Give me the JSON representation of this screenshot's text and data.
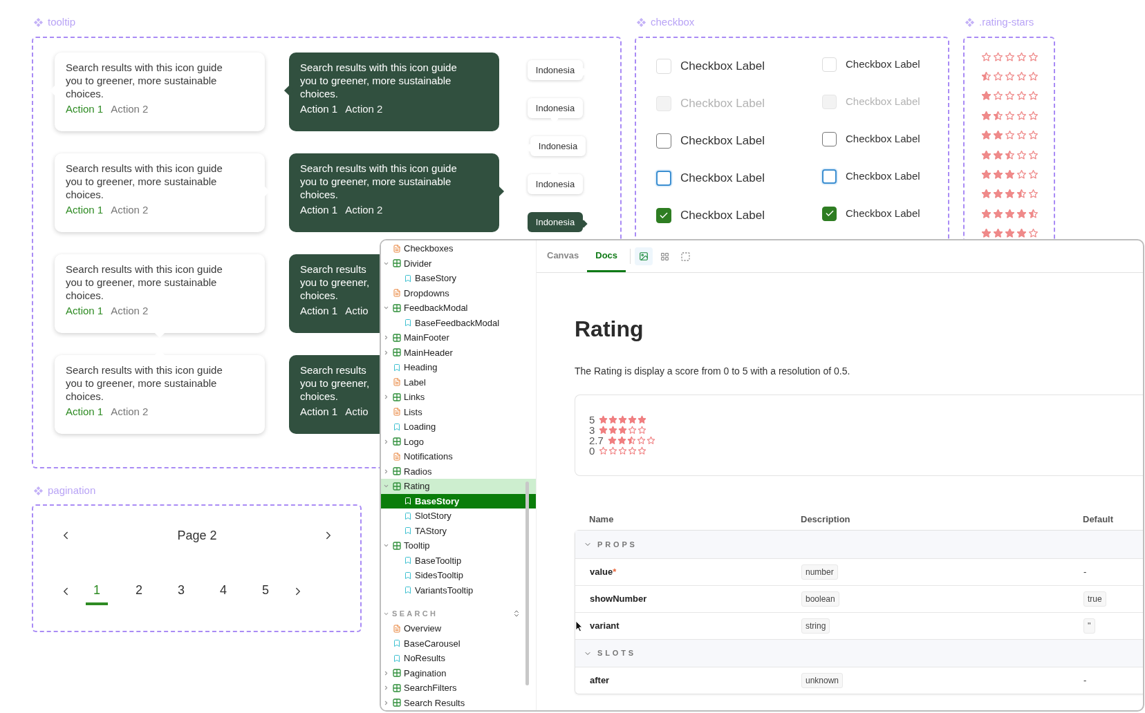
{
  "tooltip_frame": {
    "title": "tooltip",
    "light_column": [
      {
        "text": "Search results with this icon guide you to greener, more sustainable choices.",
        "actions": [
          {
            "label": "Action 1",
            "kind": "primary"
          },
          {
            "label": "Action 2",
            "kind": "secondary"
          }
        ]
      },
      {
        "text": "Search results with this icon guide you to greener, more sustainable choices.",
        "actions": [
          {
            "label": "Action 1",
            "kind": "primary"
          },
          {
            "label": "Action 2",
            "kind": "secondary"
          }
        ]
      },
      {
        "text": "Search results with this icon guide you to greener, more sustainable choices.",
        "actions": [
          {
            "label": "Action 1",
            "kind": "primary"
          },
          {
            "label": "Action 2",
            "kind": "secondary"
          }
        ]
      },
      {
        "text": "Search results with this icon guide you to greener, more sustainable choices.",
        "actions": [
          {
            "label": "Action 1",
            "kind": "primary"
          },
          {
            "label": "Action 2",
            "kind": "secondary"
          }
        ]
      }
    ],
    "dark_column": [
      {
        "text": "Search results with this icon guide you to greener, more sustainable choices.",
        "actions": [
          {
            "label": "Action 1",
            "kind": "primary"
          },
          {
            "label": "Action 2",
            "kind": "secondary"
          }
        ]
      },
      {
        "text": "Search results with this icon guide you to greener, more sustainable choices.",
        "actions": [
          {
            "label": "Action 1",
            "kind": "primary"
          },
          {
            "label": "Action 2",
            "kind": "secondary"
          }
        ]
      },
      {
        "lines": [
          "Search results",
          "you to greener,",
          "choices."
        ],
        "actions": [
          {
            "label": "Action 1",
            "kind": "primary"
          },
          {
            "label": "Actio",
            "kind": "secondary"
          }
        ]
      },
      {
        "lines": [
          "Search results",
          "you to greener,",
          "choices."
        ],
        "actions": [
          {
            "label": "Action 1",
            "kind": "primary"
          },
          {
            "label": "Actio",
            "kind": "secondary"
          }
        ]
      }
    ],
    "chips": [
      {
        "label": "Indonesia",
        "kind": "light"
      },
      {
        "label": "Indonesia",
        "kind": "light"
      },
      {
        "label": "Indonesia",
        "kind": "light"
      },
      {
        "label": "Indonesia",
        "kind": "light"
      },
      {
        "label": "Indonesia",
        "kind": "dark"
      }
    ]
  },
  "checkbox_frame": {
    "title": "checkbox",
    "columns": [
      {
        "kind": "large",
        "items": [
          {
            "label": "Checkbox Label",
            "kind": "default",
            "checked": false
          },
          {
            "label": "Checkbox Label",
            "kind": "disabled",
            "checked": false
          },
          {
            "label": "Checkbox Label",
            "kind": "hover",
            "checked": false
          },
          {
            "label": "Checkbox Label",
            "kind": "focus",
            "checked": false
          },
          {
            "label": "Checkbox Label",
            "kind": "default",
            "checked": true
          }
        ]
      },
      {
        "kind": "small",
        "items": [
          {
            "label": "Checkbox Label",
            "kind": "default",
            "checked": false
          },
          {
            "label": "Checkbox Label",
            "kind": "disabled",
            "checked": false
          },
          {
            "label": "Checkbox Label",
            "kind": "hover",
            "checked": false
          },
          {
            "label": "Checkbox Label",
            "kind": "focus",
            "checked": false
          },
          {
            "label": "Checkbox Label",
            "kind": "default",
            "checked": true
          }
        ]
      }
    ]
  },
  "rating_frame": {
    "title": ".rating-stars",
    "rows": [
      {
        "stars": 0
      },
      {
        "stars": 0.5
      },
      {
        "stars": 1
      },
      {
        "stars": 1.5
      },
      {
        "stars": 2
      },
      {
        "stars": 2.5
      },
      {
        "stars": 3
      },
      {
        "stars": 3.5
      },
      {
        "stars": 4.5
      },
      {
        "stars": 4
      }
    ]
  },
  "pagination_frame": {
    "title": "pagination",
    "page_label": "Page 2",
    "pages": [
      {
        "label": "1",
        "selected": true
      },
      {
        "label": "2",
        "selected": false
      },
      {
        "label": "3",
        "selected": false
      },
      {
        "label": "4",
        "selected": false
      },
      {
        "label": "5",
        "selected": false
      }
    ]
  },
  "storybook": {
    "sidebar": {
      "sections": [
        {
          "items": [
            {
              "label": "Checkboxes",
              "kind": "doc",
              "selected": false
            },
            {
              "label": "Divider",
              "kind": "component",
              "expanded": true,
              "selected": false,
              "children": [
                {
                  "label": "BaseStory",
                  "kind": "story",
                  "selected": false
                }
              ]
            },
            {
              "label": "Dropdowns",
              "kind": "doc",
              "selected": false
            },
            {
              "label": "FeedbackModal",
              "kind": "component",
              "expanded": true,
              "selected": false,
              "children": [
                {
                  "label": "BaseFeedbackModal",
                  "kind": "story",
                  "selected": false
                }
              ]
            },
            {
              "label": "MainFooter",
              "kind": "component",
              "expanded": false,
              "selected": false
            },
            {
              "label": "MainHeader",
              "kind": "component",
              "expanded": false,
              "selected": false
            },
            {
              "label": "Heading",
              "kind": "story",
              "selected": false
            },
            {
              "label": "Label",
              "kind": "doc",
              "selected": false
            },
            {
              "label": "Links",
              "kind": "component",
              "expanded": false,
              "selected": false
            },
            {
              "label": "Lists",
              "kind": "doc",
              "selected": false
            },
            {
              "label": "Loading",
              "kind": "story",
              "selected": false
            },
            {
              "label": "Logo",
              "kind": "component",
              "expanded": false,
              "selected": false
            },
            {
              "label": "Notifications",
              "kind": "doc",
              "selected": false
            },
            {
              "label": "Radios",
              "kind": "component",
              "expanded": false,
              "selected": false
            },
            {
              "label": "Rating",
              "kind": "component",
              "expanded": true,
              "selected": false,
              "children": [
                {
                  "label": "BaseStory",
                  "kind": "story",
                  "selected": true
                },
                {
                  "label": "SlotStory",
                  "kind": "story",
                  "selected": false
                },
                {
                  "label": "TAStory",
                  "kind": "story",
                  "selected": false
                }
              ]
            },
            {
              "label": "Tooltip",
              "kind": "component",
              "expanded": true,
              "selected": false,
              "children": [
                {
                  "label": "BaseTooltip",
                  "kind": "story",
                  "selected": false
                },
                {
                  "label": "SidesTooltip",
                  "kind": "story",
                  "selected": false
                },
                {
                  "label": "VariantsTooltip",
                  "kind": "story",
                  "selected": false
                }
              ]
            }
          ]
        },
        {
          "title": "SEARCH",
          "expanded": true,
          "items": [
            {
              "label": "Overview",
              "kind": "doc",
              "selected": false
            },
            {
              "label": "BaseCarousel",
              "kind": "story",
              "selected": false
            },
            {
              "label": "NoResults",
              "kind": "story",
              "selected": false
            },
            {
              "label": "Pagination",
              "kind": "component",
              "expanded": false,
              "selected": false
            },
            {
              "label": "SearchFilters",
              "kind": "component",
              "expanded": false,
              "selected": false
            },
            {
              "label": "Search Results",
              "kind": "component",
              "expanded": false,
              "selected": false
            }
          ]
        }
      ]
    },
    "tabs": [
      {
        "label": "Canvas",
        "selected": false
      },
      {
        "label": "Docs",
        "selected": true
      }
    ],
    "tools": [
      {
        "kind": "image",
        "selected": true
      },
      {
        "kind": "grid",
        "selected": false
      },
      {
        "kind": "outline",
        "selected": false
      }
    ],
    "docs": {
      "title": "Rating",
      "description": "The Rating is display a score from 0 to 5 with a resolution of 0.5.",
      "preview": [
        {
          "number": "5",
          "stars": 5
        },
        {
          "number": "3",
          "stars": 3
        },
        {
          "number": "2.7",
          "stars": 2.5
        },
        {
          "number": "0",
          "stars": 0
        }
      ],
      "table": {
        "columns": [
          "Name",
          "Description",
          "Default"
        ],
        "sections": [
          {
            "title": "PROPS",
            "expanded": true,
            "rows": [
              {
                "name": "value",
                "required_mark": "*",
                "type": "number",
                "default": "-",
                "kind": "plain"
              },
              {
                "name": "showNumber",
                "type": "boolean",
                "default": "true",
                "kind": "badge"
              },
              {
                "name": "variant",
                "type": "string",
                "default": "''",
                "kind": "badge"
              }
            ]
          },
          {
            "title": "SLOTS",
            "expanded": true,
            "rows": [
              {
                "name": "after",
                "type": "unknown",
                "default": "-",
                "kind": "plain"
              }
            ]
          }
        ]
      }
    }
  }
}
